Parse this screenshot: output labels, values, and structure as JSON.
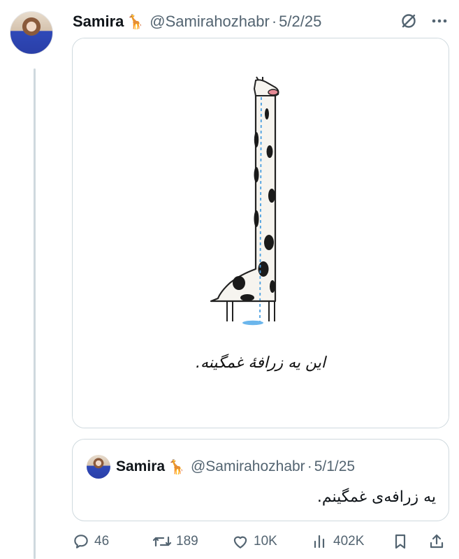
{
  "tweet": {
    "author_name": "Samira",
    "author_badge": "🦒",
    "handle": "@Samirahozhabr",
    "separator": "·",
    "date": "5/2/25",
    "media": {
      "caption_text": "این یه زرافهٔ غمگینه."
    }
  },
  "quoted": {
    "author_name": "Samira",
    "author_badge": "🦒",
    "handle": "@Samirahozhabr",
    "separator": "·",
    "date": "5/1/25",
    "text": "یه زرافه‌ی غمگینم."
  },
  "actions": {
    "replies": "46",
    "retweets": "189",
    "likes": "10K",
    "views": "402K"
  },
  "icons": {
    "grok": "no-sign-icon",
    "more": "more-dots-icon",
    "reply": "reply-icon",
    "retweet": "retweet-icon",
    "like": "heart-icon",
    "views": "views-chart-icon",
    "bookmark": "bookmark-icon",
    "share": "share-icon"
  },
  "colors": {
    "text": "#0f1419",
    "muted": "#536471",
    "border": "#cfd9de"
  }
}
